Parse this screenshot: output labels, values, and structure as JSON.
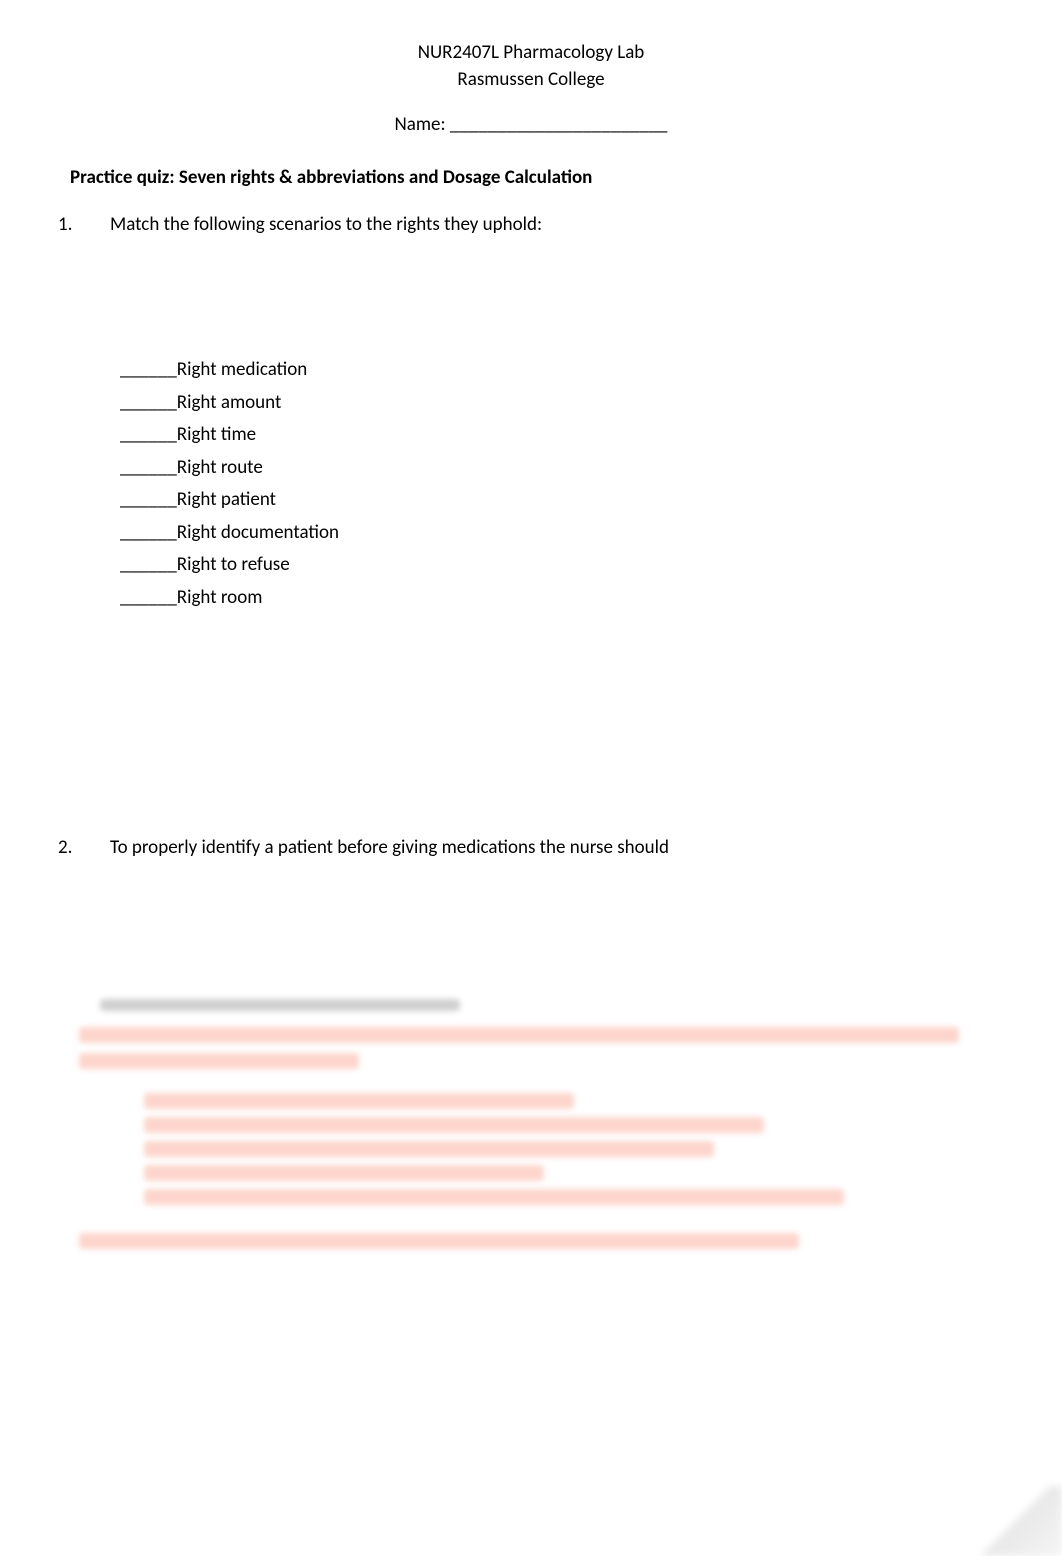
{
  "header": {
    "course": "NUR2407L Pharmacology Lab",
    "institution": "Rasmussen College"
  },
  "name_field": {
    "label": "Name:",
    "line": " _______________________"
  },
  "section_title": "Practice quiz:  Seven rights & abbreviations and Dosage Calculation",
  "questions": {
    "q1": {
      "number": "1.",
      "text": "Match the following scenarios to the rights they uphold:"
    },
    "q2": {
      "number": "2.",
      "text": "To properly identify a patient before giving medications the nurse should"
    }
  },
  "rights": {
    "blank": "______",
    "items": [
      "Right medication",
      "Right amount",
      "Right time",
      "Right route",
      "Right patient",
      "Right documentation",
      "Right to refuse",
      "Right room"
    ]
  }
}
